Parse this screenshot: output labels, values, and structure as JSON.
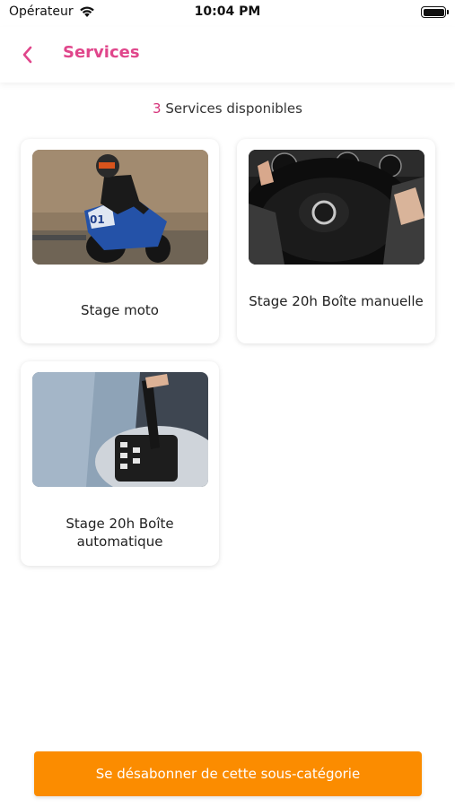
{
  "status_bar": {
    "carrier": "Opérateur",
    "time": "10:04 PM",
    "icons": [
      "wifi-icon",
      "battery-icon"
    ]
  },
  "header": {
    "title": "Services",
    "back_icon": "chevron-left-icon",
    "accent_color": "#e0468b"
  },
  "summary": {
    "count": "3",
    "label": "Services disponibles"
  },
  "services": [
    {
      "title": "Stage moto",
      "image": "motorcycle-racer-photo"
    },
    {
      "title": "Stage 20h Boîte manuelle",
      "image": "steering-wheel-photo"
    },
    {
      "title": "Stage 20h Boîte automatique",
      "image": "automatic-gear-shifter-photo"
    }
  ],
  "footer": {
    "unsubscribe_label": "Se désabonner de cette sous-catégorie",
    "button_color": "#fb8c00"
  }
}
